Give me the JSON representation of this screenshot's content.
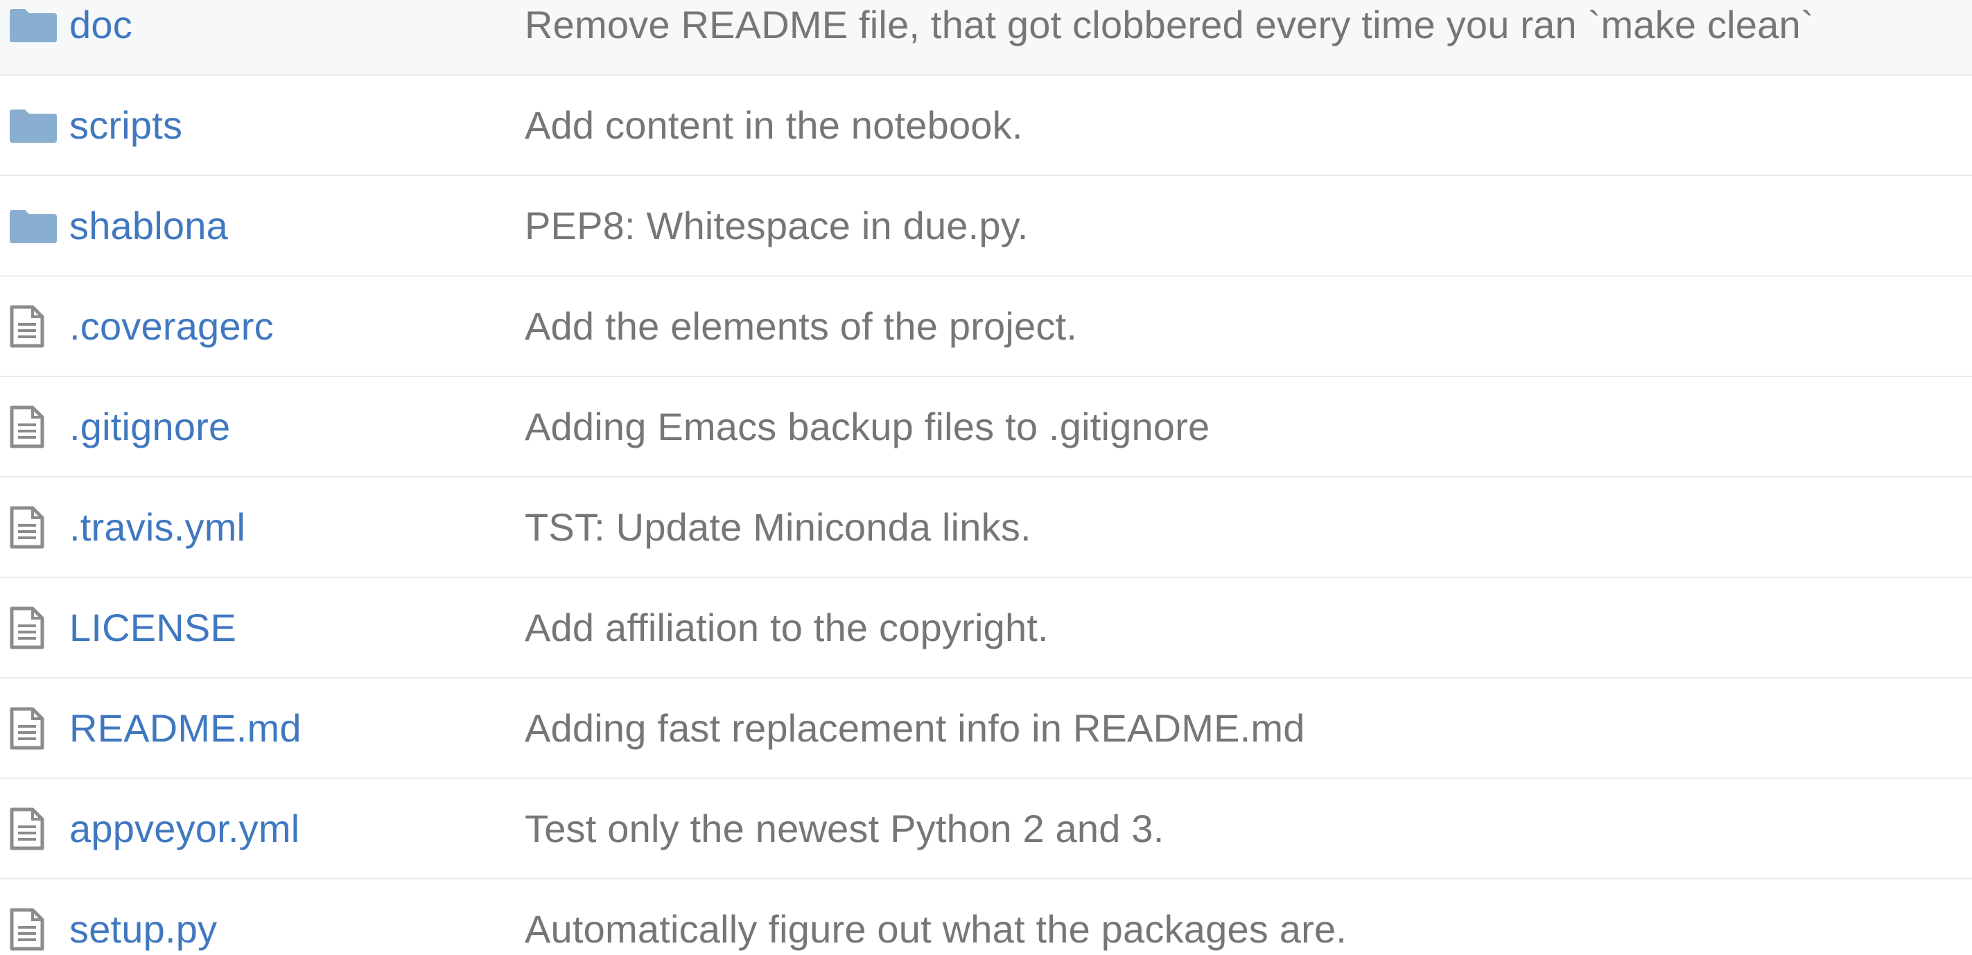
{
  "colors": {
    "link": "#4078c0",
    "message": "#767676",
    "folder_icon": "#8aaecf",
    "file_icon": "#8c8c8c",
    "row_border": "#e9ecef",
    "highlight_row": "#f6f8fa"
  },
  "files": [
    {
      "type": "folder",
      "icon": "folder-icon",
      "name": "doc",
      "message": "Remove README file, that got clobbered every time you ran `make clean`"
    },
    {
      "type": "folder",
      "icon": "folder-icon",
      "name": "scripts",
      "message": "Add content in the notebook."
    },
    {
      "type": "folder",
      "icon": "folder-icon",
      "name": "shablona",
      "message": "PEP8: Whitespace in due.py."
    },
    {
      "type": "file",
      "icon": "file-icon",
      "name": ".coveragerc",
      "message": "Add the elements of the project."
    },
    {
      "type": "file",
      "icon": "file-icon",
      "name": ".gitignore",
      "message": "Adding Emacs backup files to .gitignore"
    },
    {
      "type": "file",
      "icon": "file-icon",
      "name": ".travis.yml",
      "message": "TST: Update Miniconda links."
    },
    {
      "type": "file",
      "icon": "file-icon",
      "name": "LICENSE",
      "message": "Add affiliation to the copyright."
    },
    {
      "type": "file",
      "icon": "file-icon",
      "name": "README.md",
      "message": "Adding fast replacement info in README.md"
    },
    {
      "type": "file",
      "icon": "file-icon",
      "name": "appveyor.yml",
      "message": "Test only the newest Python 2 and 3."
    },
    {
      "type": "file",
      "icon": "file-icon",
      "name": "setup.py",
      "message": "Automatically figure out what the packages are."
    }
  ]
}
